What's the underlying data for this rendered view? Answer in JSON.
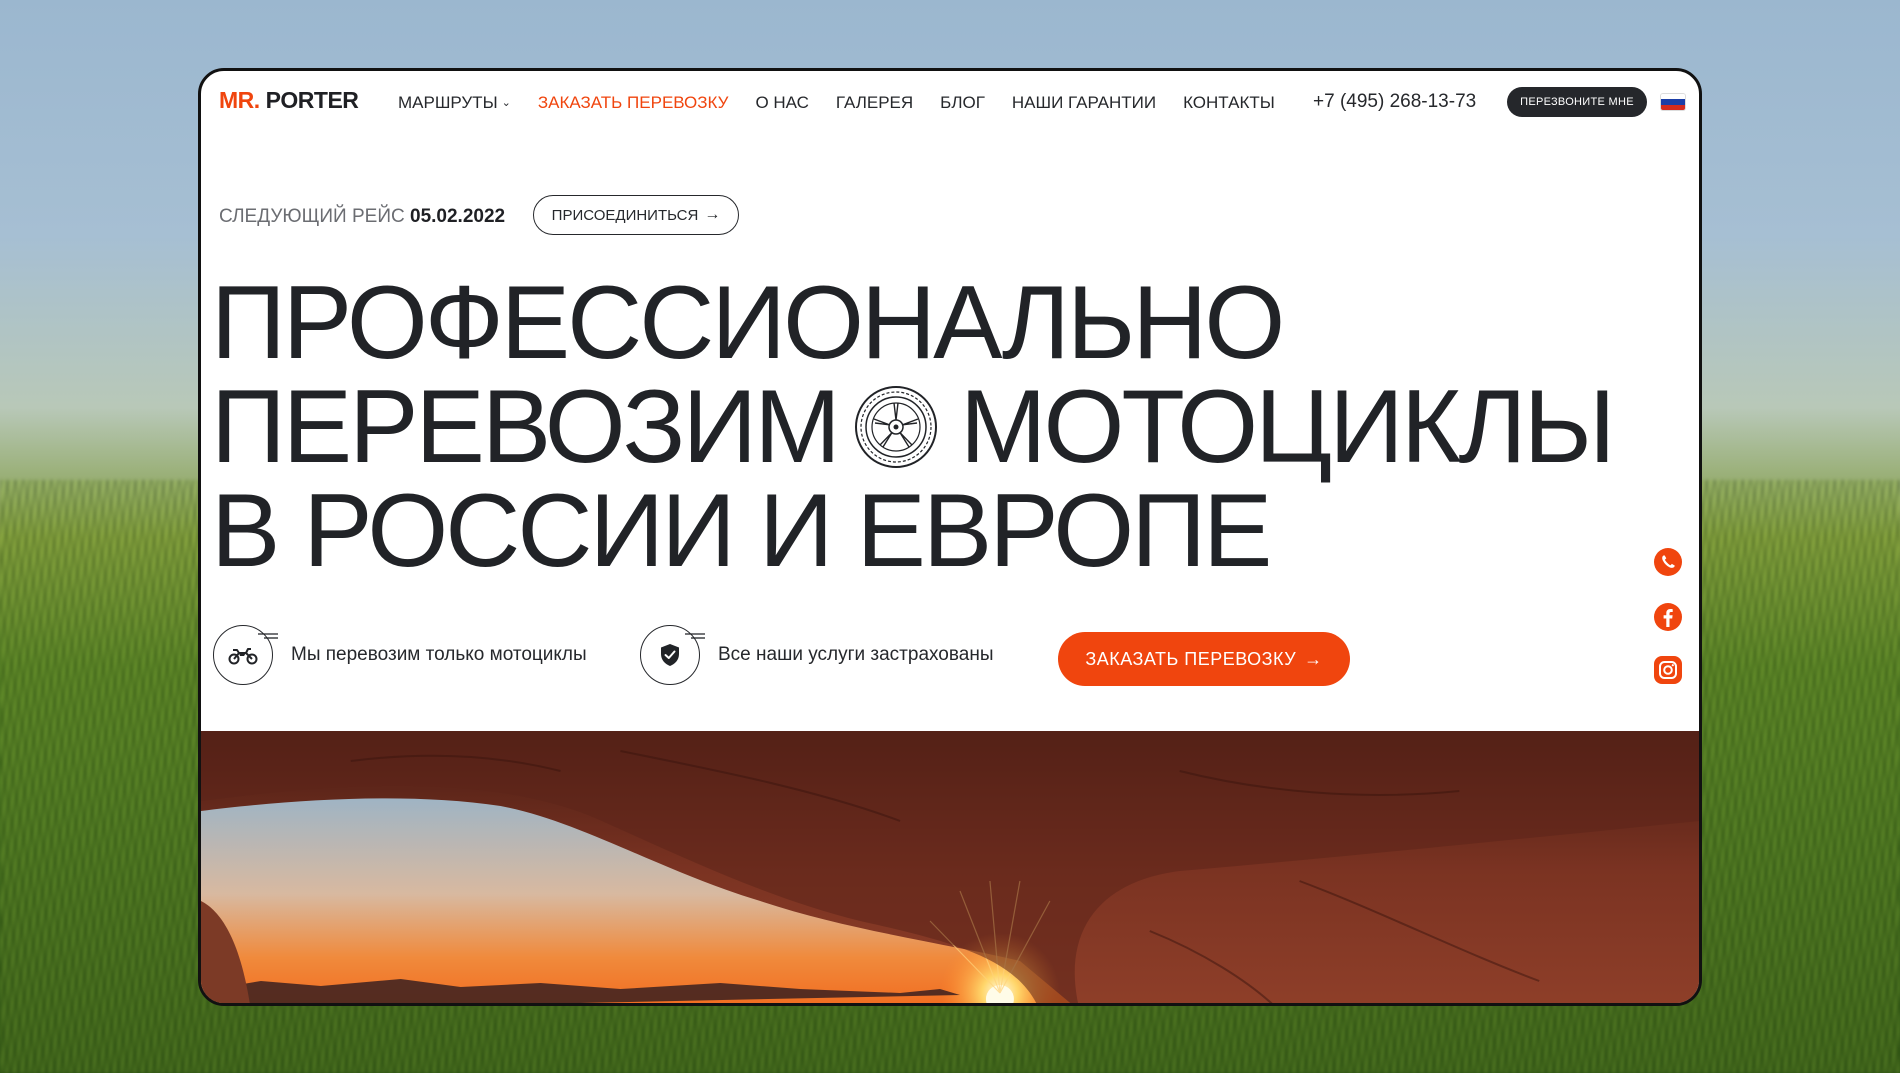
{
  "logo": {
    "prefix": "MR.",
    "name": "PORTER"
  },
  "nav": {
    "items": [
      {
        "label": "МАРШРУТЫ",
        "dropdown": true,
        "active": false
      },
      {
        "label": "ЗАКАЗАТЬ ПЕРЕВОЗКУ",
        "active": true
      },
      {
        "label": "О НАС",
        "active": false
      },
      {
        "label": "ГАЛЕРЕЯ",
        "active": false
      },
      {
        "label": "БЛОГ",
        "active": false
      },
      {
        "label": "НАШИ ГАРАНТИИ",
        "active": false
      },
      {
        "label": "КОНТАКТЫ",
        "active": false
      }
    ],
    "phone": "+7 (495) 268-13-73",
    "callback_label": "ПЕРЕЗВОНИТЕ МНЕ"
  },
  "next_trip": {
    "label": "СЛЕДУЮЩИЙ РЕЙС",
    "date": "05.02.2022",
    "join_label": "ПРИСОЕДИНИТЬСЯ"
  },
  "headline": {
    "line1": "ПРОФЕССИОНАЛЬНО",
    "line2a": "ПЕРЕВОЗИМ",
    "line2b": "МОТОЦИКЛЫ",
    "line3": "В РОССИИ И ЕВРОПЕ"
  },
  "features": [
    {
      "text": "Мы перевозим только мотоциклы",
      "icon": "motorcycle-icon"
    },
    {
      "text": "Все наши услуги застрахованы",
      "icon": "shield-check-icon"
    }
  ],
  "cta": {
    "order_label": "ЗАКАЗАТЬ ПЕРЕВОЗКУ"
  },
  "socials": [
    "whatsapp-icon",
    "facebook-icon",
    "instagram-icon"
  ],
  "colors": {
    "accent": "#f0450e",
    "text": "#212327",
    "dark_button": "#25272b"
  }
}
